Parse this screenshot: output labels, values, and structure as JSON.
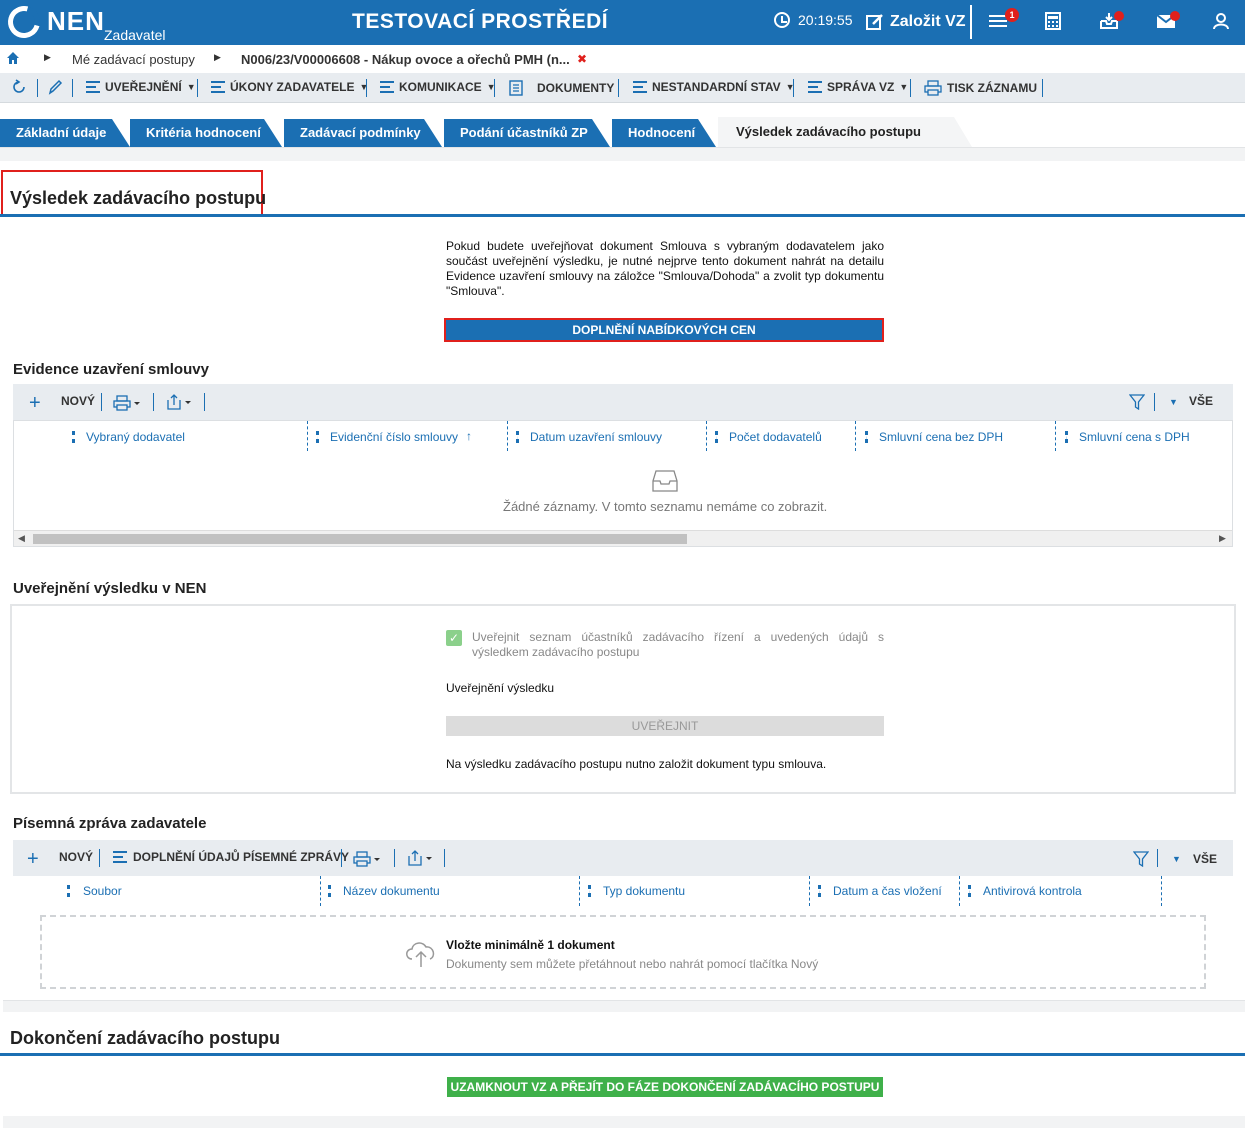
{
  "topbar": {
    "logo": "NEN",
    "logo_sub": "Zadavatel",
    "env_title": "TESTOVACÍ PROSTŘEDÍ",
    "clock": "20:19:55",
    "create_label": "Založit VZ",
    "menu_badge": "1",
    "icons": [
      "menu-icon",
      "calculator-icon",
      "inbox-icon",
      "mail-icon",
      "user-icon"
    ]
  },
  "breadcrumb": {
    "home_icon": "home-icon",
    "item1": "Mé zadávací postupy",
    "item2": "N006/23/V00006608 - Nákup ovoce a ořechů PMH (n...",
    "close": "✖"
  },
  "toolbar": {
    "items": [
      "UVEŘEJNĚNÍ",
      "ÚKONY ZADAVATELE",
      "KOMUNIKACE",
      "DOKUMENTY",
      "NESTANDARDNÍ STAV",
      "SPRÁVA VZ",
      "TISK ZÁZNAMU"
    ]
  },
  "tabs": [
    "Základní údaje",
    "Kritéria hodnocení",
    "Zadávací podmínky",
    "Podání účastníků ZP",
    "Hodnocení",
    "Výsledek zadávacího postupu"
  ],
  "section1": {
    "title": "Výsledek zadávacího postupu",
    "info": "Pokud budete uveřejňovat dokument Smlouva s vybraným dodavatelem jako součást uveřejnění výsledku, je nutné nejprve tento dokument nahrát na detailu Evidence uzavření smlouvy na záložce \"Smlouva/Dohoda\" a zvolit typ dokumentu \"Smlouva\".",
    "button": "DOPLNĚNÍ NABÍDKOVÝCH CEN"
  },
  "evidence": {
    "title": "Evidence uzavření smlouvy",
    "new": "NOVÝ",
    "all": "VŠE",
    "columns": [
      "Vybraný dodavatel",
      "Evidenční číslo smlouvy",
      "Datum uzavření smlouvy",
      "Počet dodavatelů",
      "Smluvní cena bez DPH",
      "Smluvní cena s DPH"
    ],
    "sort_arrow": "↑",
    "empty": "Žádné záznamy. V tomto seznamu nemáme co zobrazit."
  },
  "publish": {
    "title": "Uveřejnění výsledku v NEN",
    "checkbox_label": "Uveřejnit seznam účastníků zadávacího řízení a uvedených údajů s výsledkem zadávacího postupu",
    "checkbox_checked": true,
    "field_label": "Uveřejnění výsledku",
    "button": "UVEŘEJNIT",
    "note": "Na výsledku zadávacího postupu nutno založit dokument typu smlouva."
  },
  "report": {
    "title": "Písemná zpráva zadavatele",
    "new": "NOVÝ",
    "supplement": "DOPLNĚNÍ ÚDAJŮ PÍSEMNÉ ZPRÁVY",
    "all": "VŠE",
    "columns": [
      "Soubor",
      "Název dokumentu",
      "Typ dokumentu",
      "Datum a čas vložení",
      "Antivirová kontrola"
    ],
    "drop_title": "Vložte minimálně 1 dokument",
    "drop_sub": "Dokumenty sem můžete přetáhnout nebo nahrát pomocí tlačítka Nový"
  },
  "finish": {
    "title": "Dokončení zadávacího postupu",
    "button": "UZAMKNOUT VZ A PŘEJÍT DO FÁZE DOKONČENÍ ZADÁVACÍHO POSTUPU"
  },
  "colors": {
    "brand": "#1b6fb3",
    "alert": "#e0201c",
    "success": "#3fb04a"
  }
}
